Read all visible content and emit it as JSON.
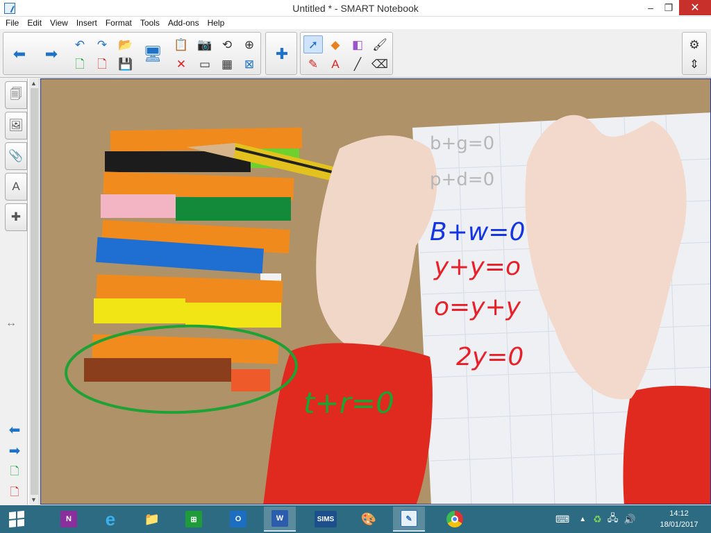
{
  "window": {
    "title": "Untitled * - SMART Notebook",
    "minimize": "–",
    "maximize": "❐",
    "close": "✕"
  },
  "menu": [
    "File",
    "Edit",
    "View",
    "Insert",
    "Format",
    "Tools",
    "Add-ons",
    "Help"
  ],
  "toolbar": {
    "previous_page_icon": "arrow-left-icon",
    "next_page_icon": "arrow-right-icon",
    "undo_icon": "undo-icon",
    "redo_icon": "redo-icon",
    "open_icon": "open-folder-icon",
    "add_page_icon": "add-page-icon",
    "delete_page_icon": "delete-page-icon",
    "save_icon": "save-icon",
    "display_icon": "display-icon",
    "paste_icon": "paste-icon",
    "delete_icon": "delete-icon",
    "screenshade_icon": "screen-shade-icon",
    "table_icon": "table-icon",
    "capture_icon": "camera-icon",
    "magic_icon": "rotate-icon",
    "fullscreen_icon": "fullscreen-icon",
    "addons_icon": "puzzle-icon",
    "select_icon": "select-arrow-icon",
    "shapes_icon": "shapes-icon",
    "eraser_icon": "eraser-icon",
    "fill_icon": "fill-icon",
    "pens_icon": "pens-icon",
    "text_icon": "text-icon",
    "line_icon": "line-icon",
    "eraser2_icon": "eraser-icon",
    "settings_icon": "gear-icon",
    "move_toolbar_icon": "up-down-arrows-icon"
  },
  "sidebar": {
    "tabs": [
      "page-sorter-icon",
      "gallery-icon",
      "attachments-icon",
      "properties-icon",
      "addons-icon"
    ],
    "resize_icon": "resize-icon",
    "bottom": [
      "arrow-left-icon",
      "arrow-right-icon",
      "add-page-icon",
      "delete-page-icon"
    ]
  },
  "ink": {
    "pencil_line1": "b+g=0",
    "pencil_line2": "p+d=0",
    "blue": "B+w=0",
    "red1": "y+y=o",
    "red2": "o=y+y",
    "red3": "2y=0",
    "green": "t+r=0"
  },
  "colors": {
    "blue_ink": "#1435e0",
    "red_ink": "#e8202a",
    "green_ink": "#1ea233"
  },
  "taskbar": {
    "apps": [
      "OneNote",
      "Internet Explorer",
      "File Explorer",
      "Store",
      "Outlook",
      "Word",
      "SIMS",
      "Paint",
      "SMART Notebook",
      "Chrome"
    ],
    "sims_label": "SIMS",
    "tray_icons": [
      "keyboard-icon",
      "chevron-up-icon",
      "sync-icon",
      "network-icon",
      "volume-icon"
    ],
    "time": "14:12",
    "date": "18/01/2017"
  }
}
